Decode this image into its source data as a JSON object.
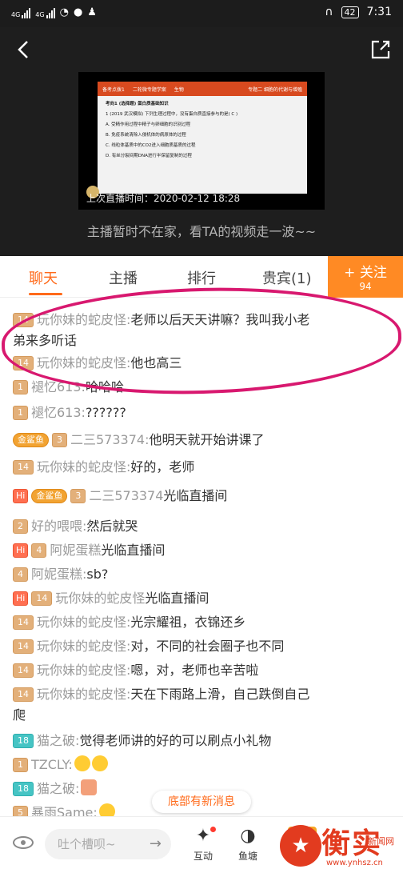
{
  "status_bar": {
    "signal1": "4G",
    "signal2": "4G",
    "battery": "42",
    "time": "7:31"
  },
  "video": {
    "slide_header": [
      "备考点拨1",
      "二轮微专题学案",
      "生物"
    ],
    "slide_right": "专题二   细胞的代谢与增殖",
    "slide_lines": [
      "考向1  (选择题) 蛋白质基础知识",
      "1 (2019 武汉模拟) 下列生理过程中，没有蛋白质直接参与的是( C )",
      "A. 受精作用过程中精子与卵细胞的识别过程",
      "B. 免疫系统清除入侵机体的病原体的过程",
      "C. 线粒体基质中的CO2进入细胞质基质的过程",
      "D. 有丝分裂间期DNA进行半保留复制的过程"
    ],
    "caption": "上次直播时间：2020-02-12  18:28",
    "away_message": "主播暂时不在家，看TA的视频走一波~~"
  },
  "tabs": [
    {
      "label": "聊天"
    },
    {
      "label": "主播"
    },
    {
      "label": "排行"
    },
    {
      "label": "贵宾(1)"
    }
  ],
  "follow": {
    "label": "+ 关注",
    "count": "94"
  },
  "chat": [
    {
      "badges": [
        "14"
      ],
      "user": "玩你妹的蛇皮怪:",
      "text": "老师以后天天讲嘛？我叫我小老"
    },
    {
      "badges": [],
      "user": "",
      "text": "弟来多听话"
    },
    {
      "badges": [
        "14"
      ],
      "user": "玩你妹的蛇皮怪:",
      "text": "他也高三"
    },
    {
      "badges": [
        "1"
      ],
      "user": "褪忆613:",
      "text": "哈哈哈"
    },
    {
      "badges": [
        "1"
      ],
      "user": "褪忆613:",
      "text": "??????"
    },
    {
      "badges": [
        "金鲨鱼",
        "3"
      ],
      "user": "二三573374:",
      "text": "他明天就开始讲课了"
    },
    {
      "badges": [
        "14"
      ],
      "user": "玩你妹的蛇皮怪:",
      "text": "好的，老师"
    },
    {
      "badges": [
        "Hi",
        "金鲨鱼",
        "3"
      ],
      "user": "二三573374",
      "text": "光临直播间"
    },
    {
      "badges": [
        "2"
      ],
      "user": "好的喂喂:",
      "text": "然后就哭"
    },
    {
      "badges": [
        "Hi",
        "4"
      ],
      "user": "阿妮蛋糕",
      "text": "光临直播间"
    },
    {
      "badges": [
        "4"
      ],
      "user": "阿妮蛋糕:",
      "text": "sb?"
    },
    {
      "badges": [
        "Hi",
        "14"
      ],
      "user": "玩你妹的蛇皮怪",
      "text": "光临直播间"
    },
    {
      "badges": [
        "14"
      ],
      "user": "玩你妹的蛇皮怪:",
      "text": "光宗耀祖，衣锦还乡"
    },
    {
      "badges": [
        "14"
      ],
      "user": "玩你妹的蛇皮怪:",
      "text": "对，不同的社会圈子也不同"
    },
    {
      "badges": [
        "14"
      ],
      "user": "玩你妹的蛇皮怪:",
      "text": "嗯，对，老师也辛苦啦"
    },
    {
      "badges": [
        "14"
      ],
      "user": "玩你妹的蛇皮怪:",
      "text": "天在下雨路上滑，自己跌倒自己"
    },
    {
      "badges": [],
      "user": "",
      "text": "爬"
    },
    {
      "badges": [
        "18"
      ],
      "user": "猫之破:",
      "text": "觉得老师讲的好的可以刷点小礼物"
    },
    {
      "badges": [
        "1"
      ],
      "user": "TZCLY:",
      "text": ""
    },
    {
      "badges": [
        "18"
      ],
      "user": "猫之破:",
      "text": ""
    },
    {
      "badges": [
        "5"
      ],
      "user": "暴雨Same:",
      "text": ""
    }
  ],
  "new_message_tip": "底部有新消息",
  "bottom_bar": {
    "input_placeholder": "吐个槽呗~",
    "send_arrow": "→",
    "interact_label": "互动",
    "fishpond_label": "鱼塘"
  },
  "watermark": {
    "title": "衡实",
    "news": "新闻网",
    "url": "www.ynhsz.cn"
  },
  "colors": {
    "accent": "#ff6a1a",
    "follow_bg": "#ff8a24",
    "highlight": "#d8186f"
  }
}
